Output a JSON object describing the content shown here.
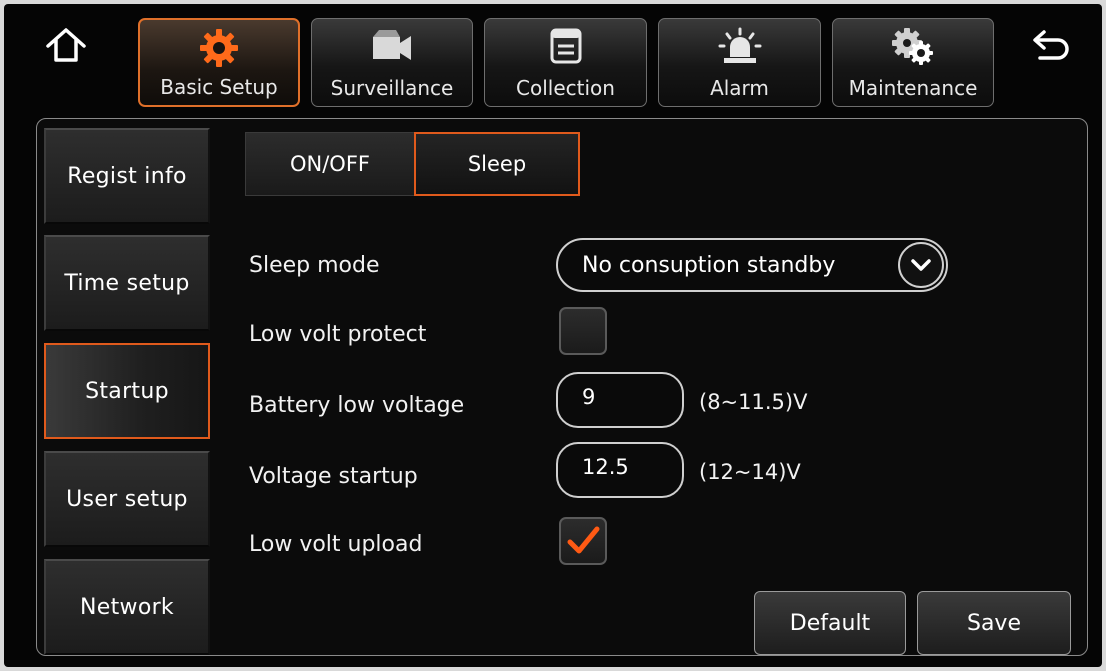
{
  "top_nav": {
    "home_icon": "home-icon",
    "back_icon": "back-arrow-icon",
    "items": [
      {
        "label": "Basic Setup",
        "icon": "gear-icon",
        "active": true
      },
      {
        "label": "Surveillance",
        "icon": "camera-icon",
        "active": false
      },
      {
        "label": "Collection",
        "icon": "document-icon",
        "active": false
      },
      {
        "label": "Alarm",
        "icon": "alarm-light-icon",
        "active": false
      },
      {
        "label": "Maintenance",
        "icon": "gears-icon",
        "active": false
      }
    ]
  },
  "sidebar": {
    "items": [
      {
        "label": "Regist info",
        "active": false
      },
      {
        "label": "Time setup",
        "active": false
      },
      {
        "label": "Startup",
        "active": true
      },
      {
        "label": "User setup",
        "active": false
      },
      {
        "label": "Network",
        "active": false
      }
    ]
  },
  "tabs": [
    {
      "label": "ON/OFF",
      "active": false
    },
    {
      "label": "Sleep",
      "active": true
    }
  ],
  "form": {
    "sleep_mode": {
      "label": "Sleep mode",
      "value": "No consuption standby"
    },
    "low_volt_protect": {
      "label": "Low volt protect",
      "checked": false
    },
    "battery_low_voltage": {
      "label": "Battery low voltage",
      "value": "9",
      "range": "(8~11.5)V"
    },
    "voltage_startup": {
      "label": "Voltage startup",
      "value": "12.5",
      "range": "(12~14)V"
    },
    "low_volt_upload": {
      "label": "Low volt upload",
      "checked": true
    }
  },
  "actions": {
    "default_label": "Default",
    "save_label": "Save"
  },
  "colors": {
    "accent": "#e05a1c",
    "background": "#050505",
    "text": "#ffffff"
  }
}
